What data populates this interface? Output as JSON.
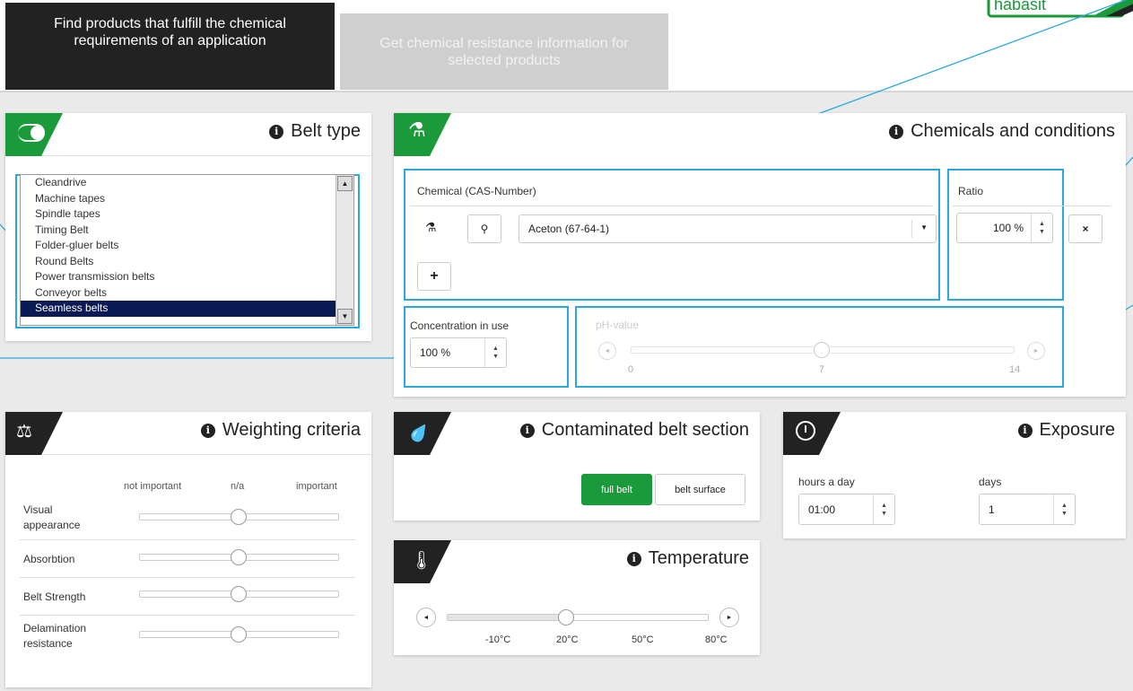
{
  "tabs": [
    {
      "label": "Find products that fulfill the chemical requirements of an application",
      "active": true
    },
    {
      "label": "Get chemical resistance information for selected products",
      "active": false
    }
  ],
  "logo": {
    "text": "habasit"
  },
  "colors": {
    "accent_green": "#1a9a3a",
    "highlight_blue": "#29a9e0",
    "dark": "#222222",
    "selected_navy": "#0a1a54"
  },
  "belt_type": {
    "title": "Belt type",
    "icon": "toggle-icon",
    "items": [
      "Cleandrive",
      "Machine tapes",
      "Spindle tapes",
      "Timing Belt",
      "Folder-gluer belts",
      "Round Belts",
      "Power transmission belts",
      "Conveyor belts",
      "Seamless belts"
    ],
    "selected": "Seamless belts"
  },
  "chemicals": {
    "title": "Chemicals and conditions",
    "icon": "flask-icon",
    "chemical_label": "Chemical (CAS-Number)",
    "chemical_value": "Aceton (67-64-1)",
    "ratio_label": "Ratio",
    "ratio_value": "100 %",
    "add_label": "+",
    "remove_label": "×",
    "concentration_label": "Concentration in use",
    "concentration_value": "100 %",
    "ph_label": "pH-value",
    "ph_ticks": [
      "0",
      "7",
      "14"
    ],
    "ph_value": 7
  },
  "weighting": {
    "title": "Weighting criteria",
    "icon": "scale-icon",
    "headers": [
      "not important",
      "n/a",
      "important"
    ],
    "rows": [
      {
        "label": "Visual appearance",
        "value": 0.5
      },
      {
        "label": "Absorbtion",
        "value": 0.5
      },
      {
        "label": "Belt Strength",
        "value": 0.5
      },
      {
        "label": "Delamination resistance",
        "value": 0.5
      }
    ]
  },
  "contaminated": {
    "title": "Contaminated belt section",
    "icon": "droplet-icon",
    "options": [
      "full belt",
      "belt surface"
    ],
    "selected": "full belt"
  },
  "temperature": {
    "title": "Temperature",
    "icon": "thermometer-icon",
    "ticks": [
      "-10°C",
      "20°C",
      "50°C",
      "80°C"
    ],
    "value_c": 20
  },
  "exposure": {
    "title": "Exposure",
    "icon": "stopwatch-icon",
    "hours_label": "hours a day",
    "hours_value": "01:00",
    "days_label": "days",
    "days_value": "1"
  }
}
